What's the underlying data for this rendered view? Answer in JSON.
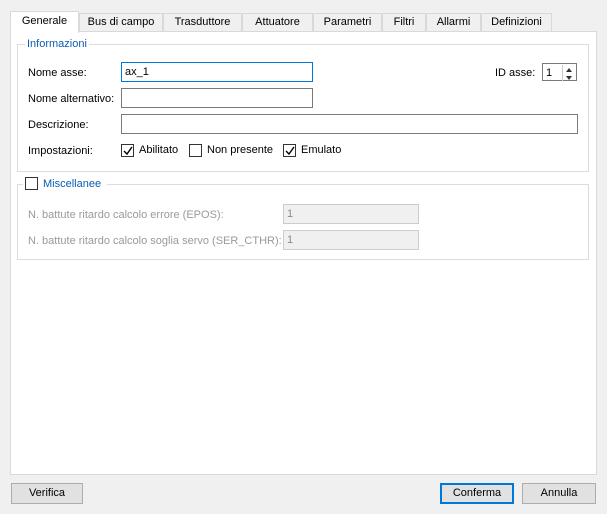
{
  "tabs": [
    {
      "label": "Generale",
      "active": true
    },
    {
      "label": "Bus di campo"
    },
    {
      "label": "Trasduttore"
    },
    {
      "label": "Attuatore"
    },
    {
      "label": "Parametri"
    },
    {
      "label": "Filtri"
    },
    {
      "label": "Allarmi"
    },
    {
      "label": "Definizioni"
    }
  ],
  "informazioni": {
    "title": "Informazioni",
    "nome_asse_label": "Nome asse:",
    "nome_asse_value": "ax_1",
    "id_asse_label": "ID asse:",
    "id_asse_value": "1",
    "nome_alternativo_label": "Nome alternativo:",
    "nome_alternativo_value": "",
    "descrizione_label": "Descrizione:",
    "descrizione_value": "",
    "impostazioni_label": "Impostazioni:",
    "abilitato_label": "Abilitato",
    "abilitato_checked": true,
    "non_presente_label": "Non presente",
    "non_presente_checked": false,
    "emulato_label": "Emulato",
    "emulato_checked": true
  },
  "miscellanee": {
    "title": "Miscellanee",
    "checked": false,
    "epos_label": "N. battute ritardo calcolo errore (EPOS):",
    "epos_value": "1",
    "ser_label": "N. battute ritardo calcolo soglia servo (SER_CTHR):",
    "ser_value": "1"
  },
  "buttons": {
    "verifica": "Verifica",
    "conferma": "Conferma",
    "annulla": "Annulla"
  }
}
